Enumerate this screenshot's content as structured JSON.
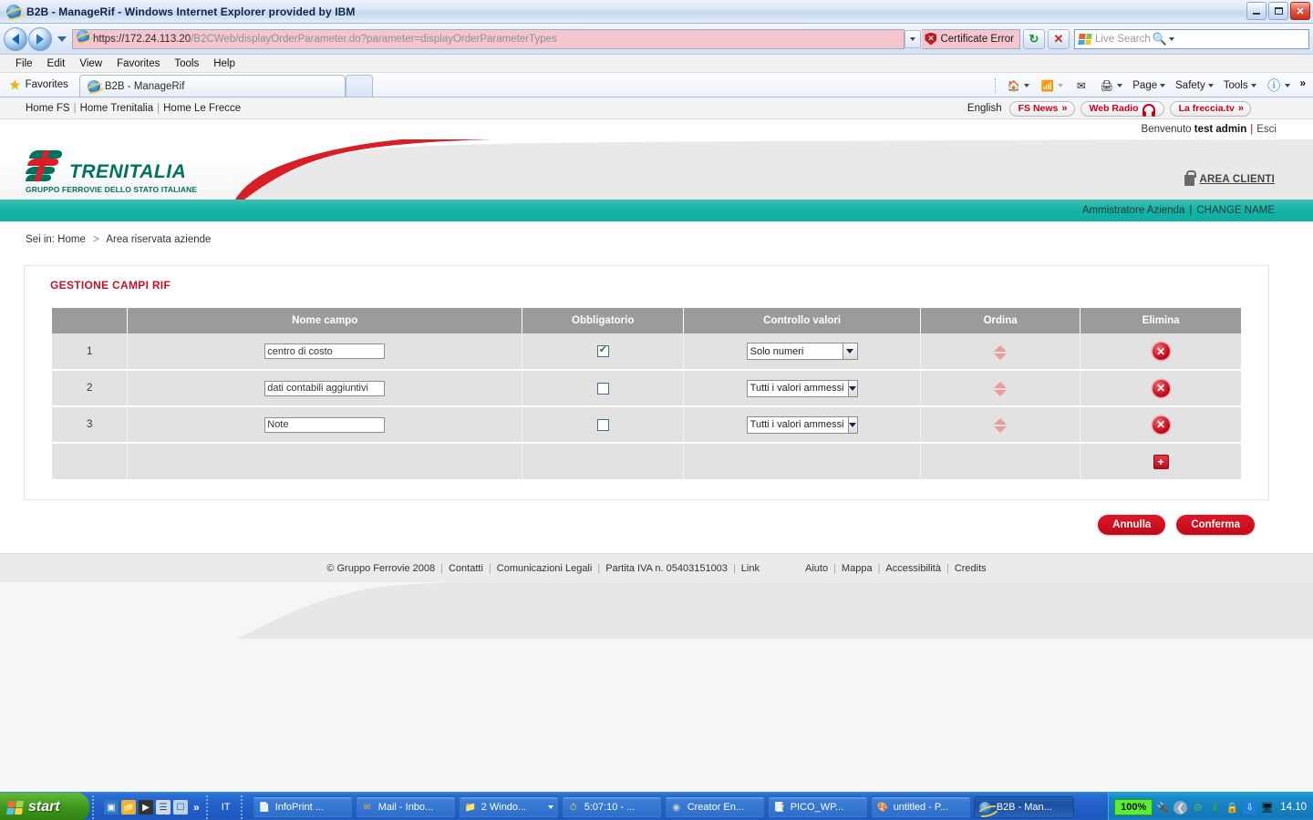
{
  "window": {
    "title": "B2B - ManageRif - Windows Internet Explorer provided by IBM",
    "minimize_label": "Minimize",
    "maximize_label": "Restore",
    "close_label": "Close"
  },
  "browser": {
    "url_domain": "https://172.24.113.20",
    "url_path": "/B2CWeb/displayOrderParameter.do?parameter=displayOrderParameterTypes",
    "certificate_error": "Certificate Error",
    "refresh_label": "Refresh",
    "stop_label": "Stop",
    "search_placeholder": "Live Search",
    "menu": [
      "File",
      "Edit",
      "View",
      "Favorites",
      "Tools",
      "Help"
    ],
    "favorites_label": "Favorites",
    "tab_title": "B2B - ManageRif",
    "commands": [
      "Page",
      "Safety",
      "Tools"
    ],
    "overflow_label": "»"
  },
  "site": {
    "top_links": [
      "Home FS",
      "Home Trenitalia",
      "Home Le Frecce"
    ],
    "language": "English",
    "promo_buttons": [
      {
        "label": "FS News",
        "icon": "chevrons-right-icon"
      },
      {
        "label": "Web Radio",
        "icon": "headphones-icon"
      },
      {
        "label": "La freccia.tv",
        "icon": "chevrons-right-icon"
      }
    ],
    "welcome_prefix": "Benvenuto",
    "welcome_user": "test admin",
    "logout_label": "Esci",
    "logo_name": "TRENITALIA",
    "logo_tagline": "GRUPPO FERROVIE DELLO STATO ITALIANE",
    "area_clienti": "AREA CLIENTI",
    "role_label": "Ammistratore Azienda",
    "change_name_label": "CHANGE NAME",
    "breadcrumb_prefix": "Sei in:",
    "breadcrumb": [
      "Home",
      "Area riservata aziende"
    ]
  },
  "panel": {
    "title": "GESTIONE CAMPI RIF",
    "columns": [
      "",
      "Nome campo",
      "Obbligatorio",
      "Controllo valori",
      "Ordina",
      "Elimina"
    ],
    "rows": [
      {
        "index": "1",
        "field_name": "centro di costo",
        "required": true,
        "value_control": "Solo numeri",
        "sort_label": "Ordina",
        "delete_label": "Elimina"
      },
      {
        "index": "2",
        "field_name": "dati contabili aggiuntivi",
        "required": false,
        "value_control": "Tutti i valori ammessi",
        "sort_label": "Ordina",
        "delete_label": "Elimina"
      },
      {
        "index": "3",
        "field_name": "Note",
        "required": false,
        "value_control": "Tutti i valori ammessi",
        "sort_label": "Ordina",
        "delete_label": "Elimina"
      }
    ],
    "add_label": "+",
    "buttons": {
      "cancel": "Annulla",
      "confirm": "Conferma"
    }
  },
  "footer": {
    "left_links": [
      "© Gruppo Ferrovie 2008",
      "Contatti",
      "Comunicazioni Legali",
      "Partita IVA n. 05403151003",
      "Link"
    ],
    "right_links": [
      "Aiuto",
      "Mappa",
      "Accessibilità",
      "Credits"
    ]
  },
  "taskbar": {
    "start_label": "start",
    "ime_label": "IT",
    "quick_launch": [
      "show-desktop-icon",
      "folder-icon",
      "media-icon",
      "notes-icon",
      "window-icon"
    ],
    "overflow": "»",
    "tasks": [
      {
        "label": "InfoPrint ...",
        "icon": "document-icon",
        "active": false
      },
      {
        "label": "Mail - Inbo...",
        "icon": "mail-icon",
        "active": false
      },
      {
        "label": "2 Windo...",
        "icon": "folder-icon",
        "active": false,
        "has_caret": true
      },
      {
        "label": "5:07:10  - ...",
        "icon": "clock-icon",
        "active": false
      },
      {
        "label": "Creator En...",
        "icon": "disc-icon",
        "active": false
      },
      {
        "label": "PICO_WP...",
        "icon": "word-icon",
        "active": false
      },
      {
        "label": "untitled - P...",
        "icon": "paint-icon",
        "active": false
      },
      {
        "label": "B2B - Man...",
        "icon": "ie-icon",
        "active": true
      }
    ],
    "battery": "100%",
    "tray_icons": [
      "power-plug-icon",
      "back-arrow-icon",
      "safety-icon",
      "network-download-icon",
      "security-icon",
      "bluetooth-icon",
      "network-icon"
    ],
    "clock": "14.10"
  },
  "colors": {
    "brand_teal": "#00735f",
    "brand_red": "#c8102e",
    "accent_red": "#c00a18",
    "header_gray": "#9b9b9b",
    "row_gray": "#e2e2e2"
  }
}
